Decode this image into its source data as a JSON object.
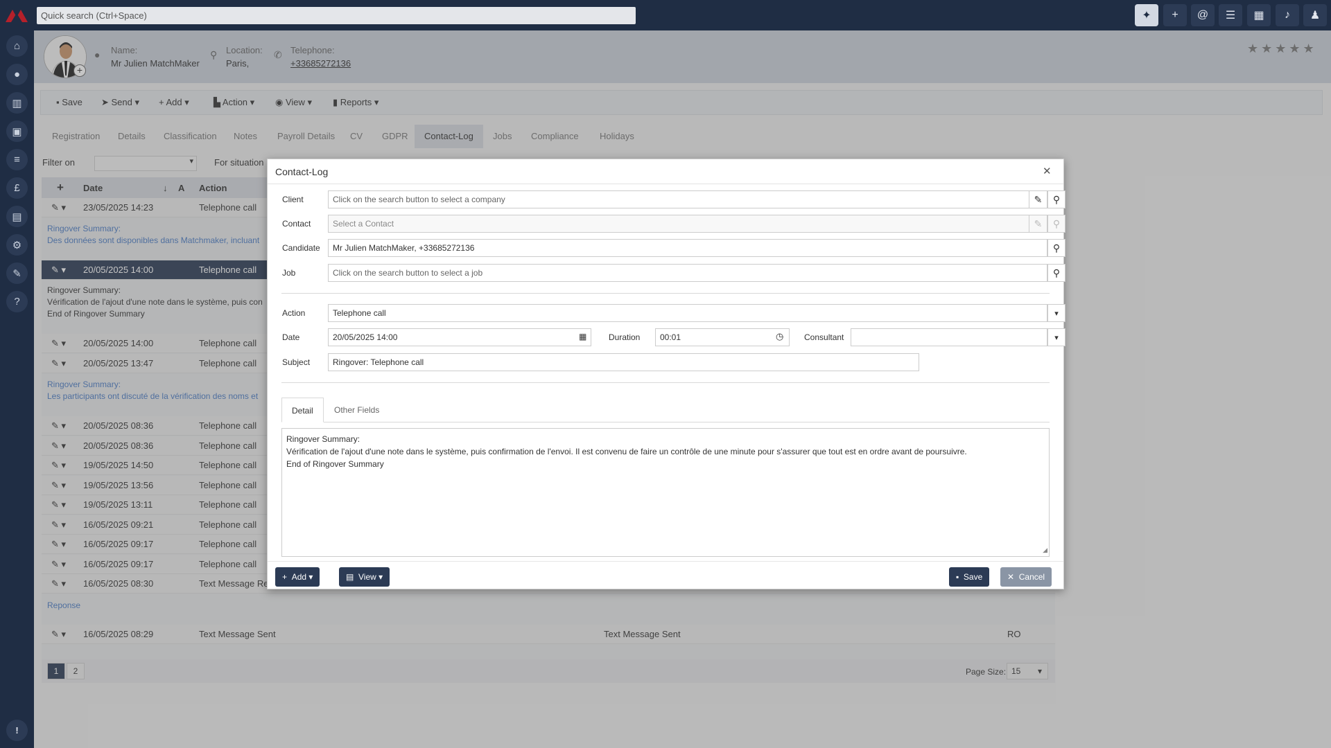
{
  "topbar": {
    "search_placeholder": "Quick search (Ctrl+Space)"
  },
  "header": {
    "name_label": "Name:",
    "name_value": "Mr Julien MatchMaker",
    "location_label": "Location:",
    "location_value": "Paris,",
    "telephone_label": "Telephone:",
    "telephone_value": "+33685272136",
    "rating_stars": 5
  },
  "toolbar": {
    "save": "Save",
    "send": "Send",
    "add": "Add",
    "action": "Action",
    "view": "View",
    "reports": "Reports"
  },
  "tabs": [
    "Registration",
    "Details",
    "Classification",
    "Notes",
    "Payroll Details",
    "CV",
    "GDPR",
    "Contact-Log",
    "Jobs",
    "Compliance",
    "Holidays"
  ],
  "active_tab": "Contact-Log",
  "filter": {
    "filter_on_label": "Filter on",
    "for_situation_label": "For situation"
  },
  "grid": {
    "columns": [
      "Date",
      "A",
      "Action"
    ],
    "rows": [
      {
        "date": "23/05/2025 14:23",
        "action": "Telephone call"
      },
      {
        "date": "20/05/2025 14:00",
        "action": "Telephone call"
      },
      {
        "date": "20/05/2025 14:00",
        "action": "Telephone call"
      },
      {
        "date": "20/05/2025 13:47",
        "action": "Telephone call"
      },
      {
        "date": "20/05/2025 08:36",
        "action": "Telephone call"
      },
      {
        "date": "20/05/2025 08:36",
        "action": "Telephone call"
      },
      {
        "date": "19/05/2025 14:50",
        "action": "Telephone call"
      },
      {
        "date": "19/05/2025 13:56",
        "action": "Telephone call"
      },
      {
        "date": "19/05/2025 13:11",
        "action": "Telephone call"
      },
      {
        "date": "16/05/2025 09:21",
        "action": "Telephone call"
      },
      {
        "date": "16/05/2025 09:17",
        "action": "Telephone call"
      },
      {
        "date": "16/05/2025 09:17",
        "action": "Telephone call"
      },
      {
        "date": "16/05/2025 08:30",
        "action": "Text Message Rec"
      },
      {
        "date": "16/05/2025 08:29",
        "action": "Text Message Sent",
        "subject": "Text Message Sent",
        "consultant": "RO"
      }
    ],
    "notes": {
      "n1_line1": "Ringover Summary:",
      "n1_line2": "Des données sont disponibles dans Matchmaker, incluant",
      "n2_line1": "Ringover Summary:",
      "n2_line2": "Vérification de l'ajout d'une note dans le système, puis con",
      "n2_line3": "End of Ringover Summary",
      "n3_line1": "Ringover Summary:",
      "n3_line2": "Les participants ont discuté de la vérification des noms et",
      "n4_line1": "Reponse"
    },
    "pages": [
      "1",
      "2"
    ],
    "page_size_label": "Page Size:",
    "page_size_value": "15"
  },
  "modal": {
    "title": "Contact-Log",
    "client_label": "Client",
    "client_placeholder": "Click on the search button to select a company",
    "contact_label": "Contact",
    "contact_placeholder": "Select a Contact",
    "candidate_label": "Candidate",
    "candidate_value": "Mr Julien MatchMaker, +33685272136",
    "job_label": "Job",
    "job_placeholder": "Click on the search button to select a job",
    "action_label": "Action",
    "action_value": "Telephone call",
    "date_label": "Date",
    "date_value": "20/05/2025 14:00",
    "duration_label": "Duration",
    "duration_value": "00:01",
    "consultant_label": "Consultant",
    "consultant_value": "",
    "subject_label": "Subject",
    "subject_value": "Ringover: Telephone call",
    "tab_detail": "Detail",
    "tab_other": "Other Fields",
    "detail_line1": "Ringover Summary:",
    "detail_line2": "Vérification de l'ajout d'une note dans le système, puis confirmation de l'envoi. Il est convenu de faire un contrôle de une minute pour s'assurer que tout est en ordre avant de poursuivre.",
    "detail_line3": "End of Ringover Summary",
    "add_button": "Add",
    "view_button": "View",
    "save_button": "Save",
    "cancel_button": "Cancel"
  }
}
